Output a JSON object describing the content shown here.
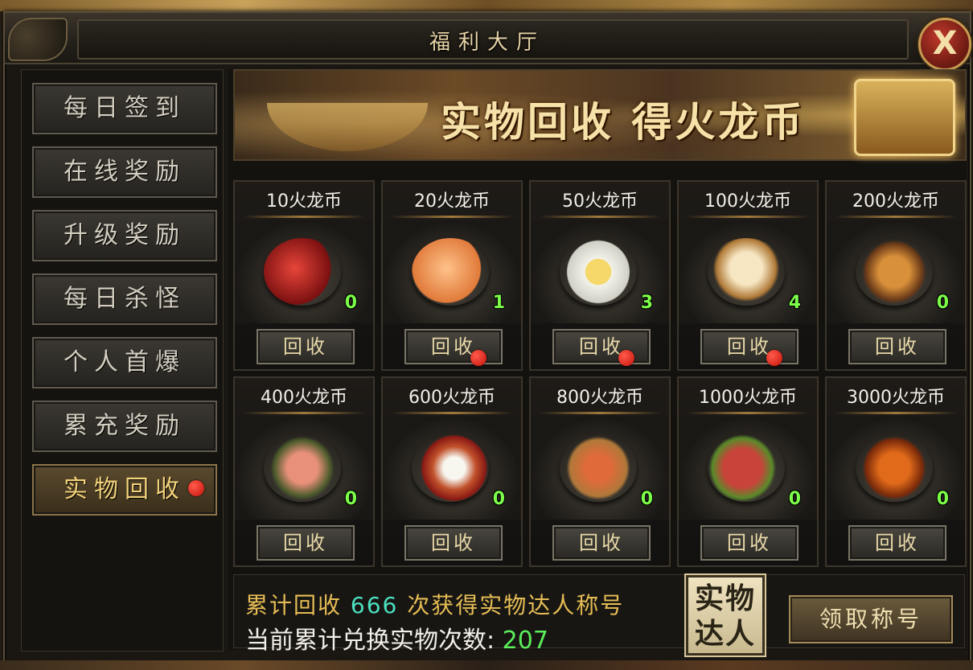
{
  "window": {
    "title": "福利大厅",
    "close_label": "X"
  },
  "sidebar": {
    "items": [
      {
        "label": "每日签到"
      },
      {
        "label": "在线奖励"
      },
      {
        "label": "升级奖励"
      },
      {
        "label": "每日杀怪"
      },
      {
        "label": "个人首爆"
      },
      {
        "label": "累充奖励"
      },
      {
        "label": "实物回收",
        "active": true
      }
    ]
  },
  "banner": {
    "text": "实物回收  得火龙币"
  },
  "items": [
    {
      "price": "10火龙币",
      "count": "0",
      "button": "回收",
      "item": "cherries",
      "notify": false
    },
    {
      "price": "20火龙币",
      "count": "1",
      "button": "回收",
      "item": "peaches",
      "notify": true
    },
    {
      "price": "50火龙币",
      "count": "3",
      "button": "回收",
      "item": "omelette-plate",
      "notify": true
    },
    {
      "price": "100火龙币",
      "count": "4",
      "button": "回收",
      "item": "steamed-buns",
      "notify": true
    },
    {
      "price": "200火龙币",
      "count": "0",
      "button": "回收",
      "item": "burger-cola",
      "notify": false
    },
    {
      "price": "400火龙币",
      "count": "0",
      "button": "回收",
      "item": "pork-can",
      "notify": false
    },
    {
      "price": "600火龙币",
      "count": "0",
      "button": "回收",
      "item": "curry-rice",
      "notify": false
    },
    {
      "price": "800火龙币",
      "count": "0",
      "button": "回收",
      "item": "hot-pot",
      "notify": false
    },
    {
      "price": "1000火龙币",
      "count": "0",
      "button": "回收",
      "item": "steak",
      "notify": false
    },
    {
      "price": "3000火龙币",
      "count": "0",
      "button": "回收",
      "item": "lobster",
      "notify": false
    }
  ],
  "footer": {
    "line1_pre": "累计回收",
    "line1_num": "666",
    "line1_post": "次获得实物达人称号",
    "line2_label": "当前累计兑换实物次数:",
    "line2_num": "207",
    "badge": "实物达人",
    "claim_button": "领取称号"
  },
  "colors": {
    "accent_gold": "#e6bd55",
    "count_green": "#7dff4a",
    "highlight_cyan": "#4ce0c0",
    "notify_red": "#e02416"
  }
}
